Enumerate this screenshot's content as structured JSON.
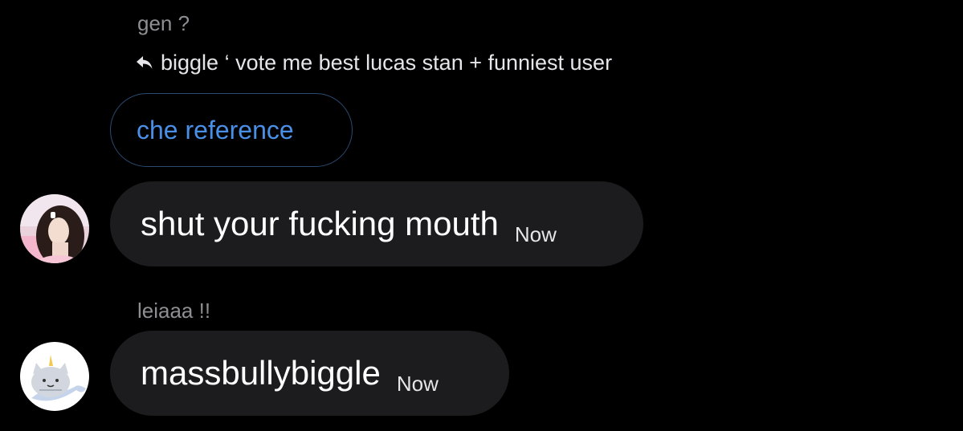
{
  "thread": {
    "sender_1": "gen ?",
    "reply_preview": "biggle ‘ vote me best lucas stan + funniest user",
    "reply_message": "che reference",
    "message_2": {
      "text": "shut your fucking mouth",
      "time": "Now"
    },
    "sender_3": "leiaaa !!",
    "message_3": {
      "text": "massbullybiggle",
      "time": "Now"
    }
  },
  "icons": {
    "reply": "reply-arrow-icon",
    "avatar_1": "profile-photo",
    "avatar_2": "cat-unicorn-avatar"
  },
  "colors": {
    "background": "#000000",
    "bubble": "#1c1c1e",
    "accent": "#4a8fe7",
    "sender_label": "#8e8e93"
  }
}
